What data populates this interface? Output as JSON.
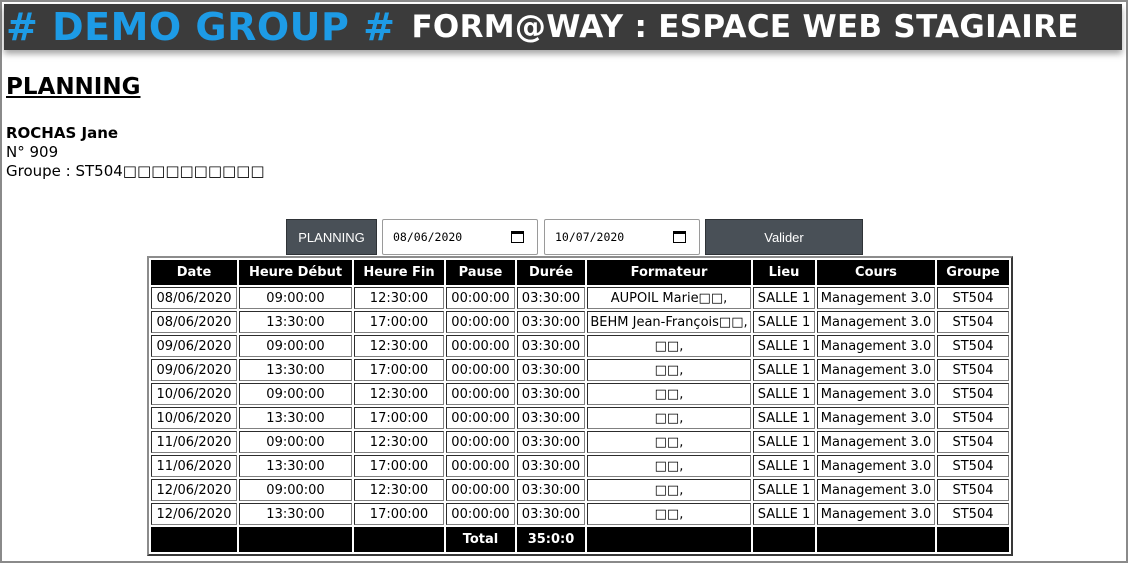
{
  "header": {
    "brand": "# DEMO GROUP #",
    "subtitle": "FORM@WAY : ESPACE WEB STAGIAIRE"
  },
  "page_title": "PLANNING",
  "trainee": {
    "name": "ROCHAS Jane",
    "number": "N° 909",
    "group": "Groupe : ST504□□□□□□□□□□"
  },
  "controls": {
    "planning_label": "PLANNING",
    "date_from": "08/06/2020",
    "date_to": "10/07/2020",
    "submit_label": "Valider"
  },
  "table": {
    "columns": [
      "Date",
      "Heure Début",
      "Heure Fin",
      "Pause",
      "Durée",
      "Formateur",
      "Lieu",
      "Cours",
      "Groupe"
    ],
    "rows": [
      [
        "08/06/2020",
        "09:00:00",
        "12:30:00",
        "00:00:00",
        "03:30:00",
        "AUPOIL Marie□□,",
        "SALLE 1",
        "Management 3.0",
        "ST504"
      ],
      [
        "08/06/2020",
        "13:30:00",
        "17:00:00",
        "00:00:00",
        "03:30:00",
        "BEHM Jean-François□□,",
        "SALLE 1",
        "Management 3.0",
        "ST504"
      ],
      [
        "09/06/2020",
        "09:00:00",
        "12:30:00",
        "00:00:00",
        "03:30:00",
        "□□,",
        "SALLE 1",
        "Management 3.0",
        "ST504"
      ],
      [
        "09/06/2020",
        "13:30:00",
        "17:00:00",
        "00:00:00",
        "03:30:00",
        "□□,",
        "SALLE 1",
        "Management 3.0",
        "ST504"
      ],
      [
        "10/06/2020",
        "09:00:00",
        "12:30:00",
        "00:00:00",
        "03:30:00",
        "□□,",
        "SALLE 1",
        "Management 3.0",
        "ST504"
      ],
      [
        "10/06/2020",
        "13:30:00",
        "17:00:00",
        "00:00:00",
        "03:30:00",
        "□□,",
        "SALLE 1",
        "Management 3.0",
        "ST504"
      ],
      [
        "11/06/2020",
        "09:00:00",
        "12:30:00",
        "00:00:00",
        "03:30:00",
        "□□,",
        "SALLE 1",
        "Management 3.0",
        "ST504"
      ],
      [
        "11/06/2020",
        "13:30:00",
        "17:00:00",
        "00:00:00",
        "03:30:00",
        "□□,",
        "SALLE 1",
        "Management 3.0",
        "ST504"
      ],
      [
        "12/06/2020",
        "09:00:00",
        "12:30:00",
        "00:00:00",
        "03:30:00",
        "□□,",
        "SALLE 1",
        "Management 3.0",
        "ST504"
      ],
      [
        "12/06/2020",
        "13:30:00",
        "17:00:00",
        "00:00:00",
        "03:30:00",
        "□□,",
        "SALLE 1",
        "Management 3.0",
        "ST504"
      ]
    ],
    "total_label": "Total",
    "total_value": "35:0:0"
  },
  "colors": {
    "banner_bg": "#3b3b3b",
    "brand": "#1d9be6",
    "button_bg": "#495057",
    "table_header": "#000000"
  }
}
